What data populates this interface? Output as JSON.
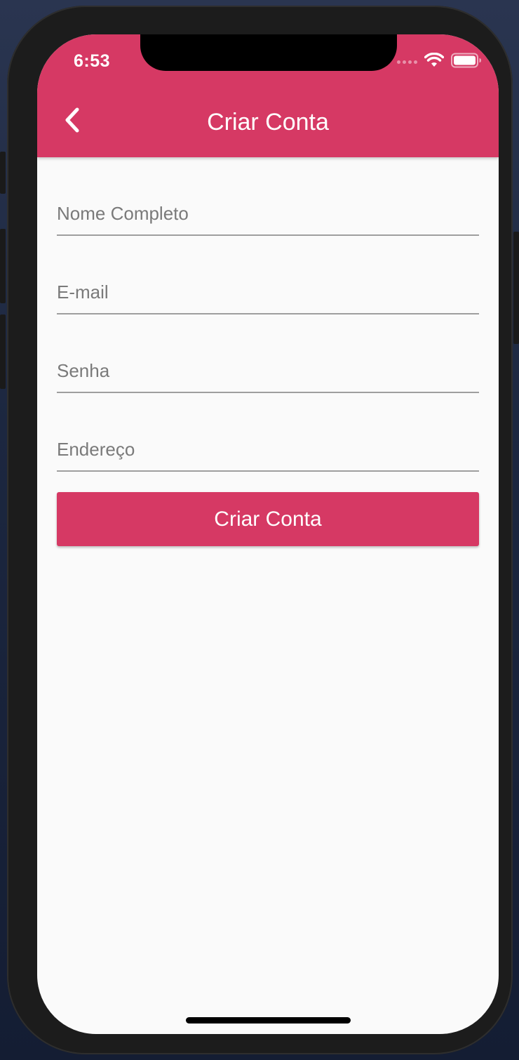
{
  "status_bar": {
    "time": "6:53",
    "icons": [
      "signal-dots-icon",
      "wifi-icon",
      "battery-icon"
    ]
  },
  "header": {
    "title": "Criar Conta",
    "back_icon": "chevron-left-icon"
  },
  "form": {
    "fields": [
      {
        "placeholder": "Nome Completo",
        "value": ""
      },
      {
        "placeholder": "E-mail",
        "value": ""
      },
      {
        "placeholder": "Senha",
        "value": ""
      },
      {
        "placeholder": "Endereço",
        "value": ""
      }
    ],
    "submit_label": "Criar Conta"
  },
  "colors": {
    "accent": "#d63964",
    "background": "#fafafa",
    "underline": "#9e9e9e",
    "placeholder": "#7a7a7a"
  }
}
